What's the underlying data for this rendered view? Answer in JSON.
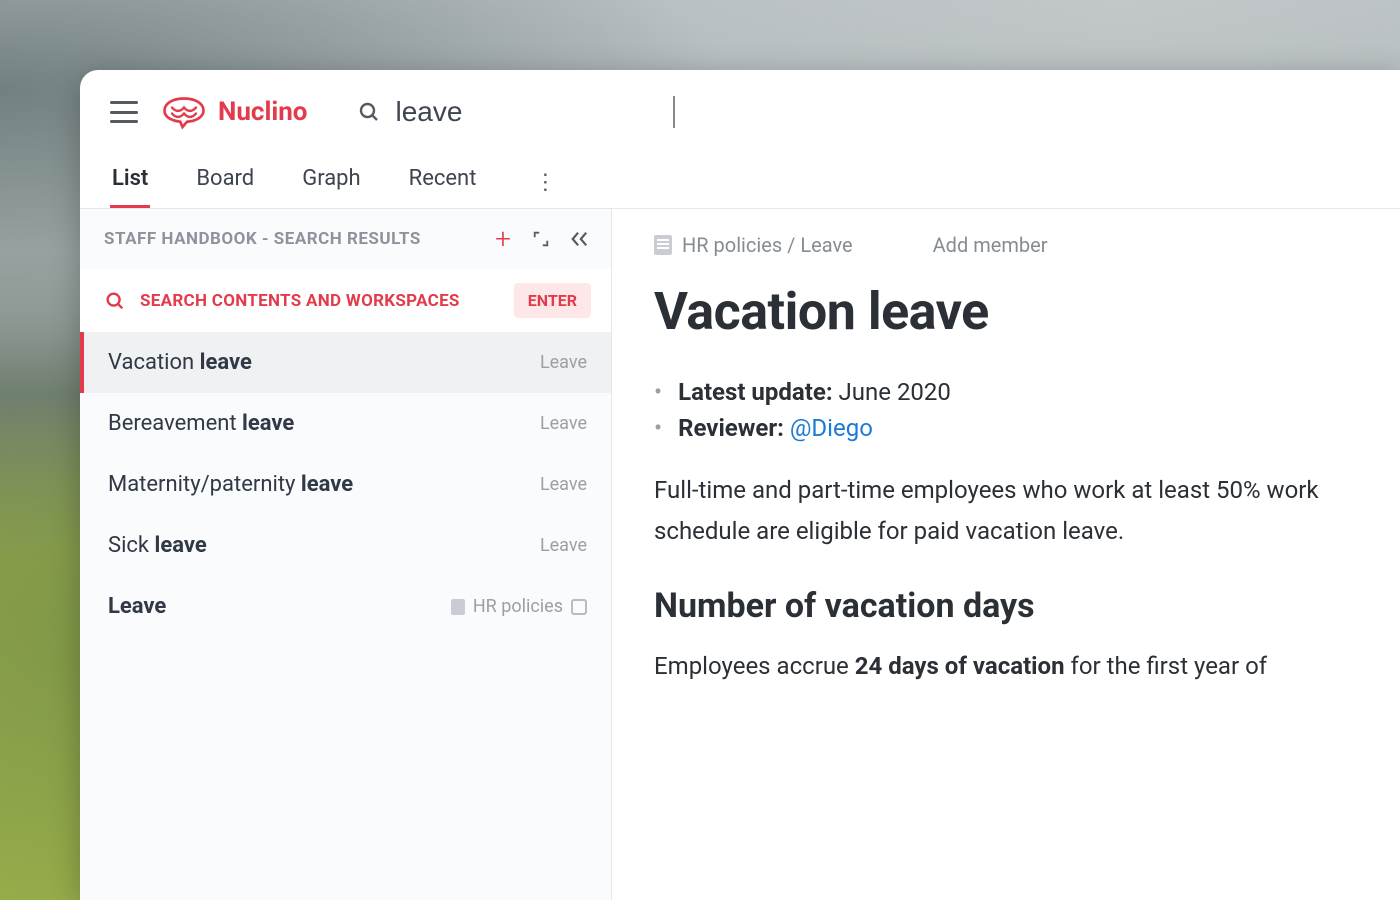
{
  "brand": {
    "name": "Nuclino"
  },
  "search": {
    "value": "leave"
  },
  "tabs": {
    "items": [
      {
        "label": "List",
        "active": true
      },
      {
        "label": "Board",
        "active": false
      },
      {
        "label": "Graph",
        "active": false
      },
      {
        "label": "Recent",
        "active": false
      }
    ]
  },
  "sidebar": {
    "header_title": "STAFF HANDBOOK - SEARCH RESULTS",
    "search_contents_label": "SEARCH CONTENTS AND WORKSPACES",
    "enter_badge": "ENTER",
    "results": [
      {
        "title_pre": "Vacation ",
        "title_bold": "leave",
        "title_post": "",
        "category": "Leave",
        "active": true,
        "has_page_icon": false,
        "has_collection_icon": false
      },
      {
        "title_pre": "Bereavement ",
        "title_bold": "leave",
        "title_post": "",
        "category": "Leave",
        "active": false,
        "has_page_icon": false,
        "has_collection_icon": false
      },
      {
        "title_pre": "Maternity/paternity ",
        "title_bold": "leave",
        "title_post": "",
        "category": "Leave",
        "active": false,
        "has_page_icon": false,
        "has_collection_icon": false
      },
      {
        "title_pre": "Sick ",
        "title_bold": "leave",
        "title_post": "",
        "category": "Leave",
        "active": false,
        "has_page_icon": false,
        "has_collection_icon": false
      },
      {
        "title_pre": "",
        "title_bold": "Leave",
        "title_post": "",
        "category": "HR policies",
        "active": false,
        "has_page_icon": true,
        "has_collection_icon": true
      }
    ]
  },
  "doc": {
    "breadcrumb": "HR policies / Leave",
    "add_member": "Add member",
    "title": "Vacation leave",
    "meta": {
      "latest_update_label": "Latest update:",
      "latest_update_value": "June 2020",
      "reviewer_label": "Reviewer:",
      "reviewer_mention": "@Diego"
    },
    "intro": "Full-time and part-time employees who work at least 50% work schedule are eligible for paid vacation leave.",
    "section_heading": "Number of vacation days",
    "section_body_pre": "Employees accrue ",
    "section_body_bold": "24 days of vacation",
    "section_body_post": " for the first year of"
  }
}
